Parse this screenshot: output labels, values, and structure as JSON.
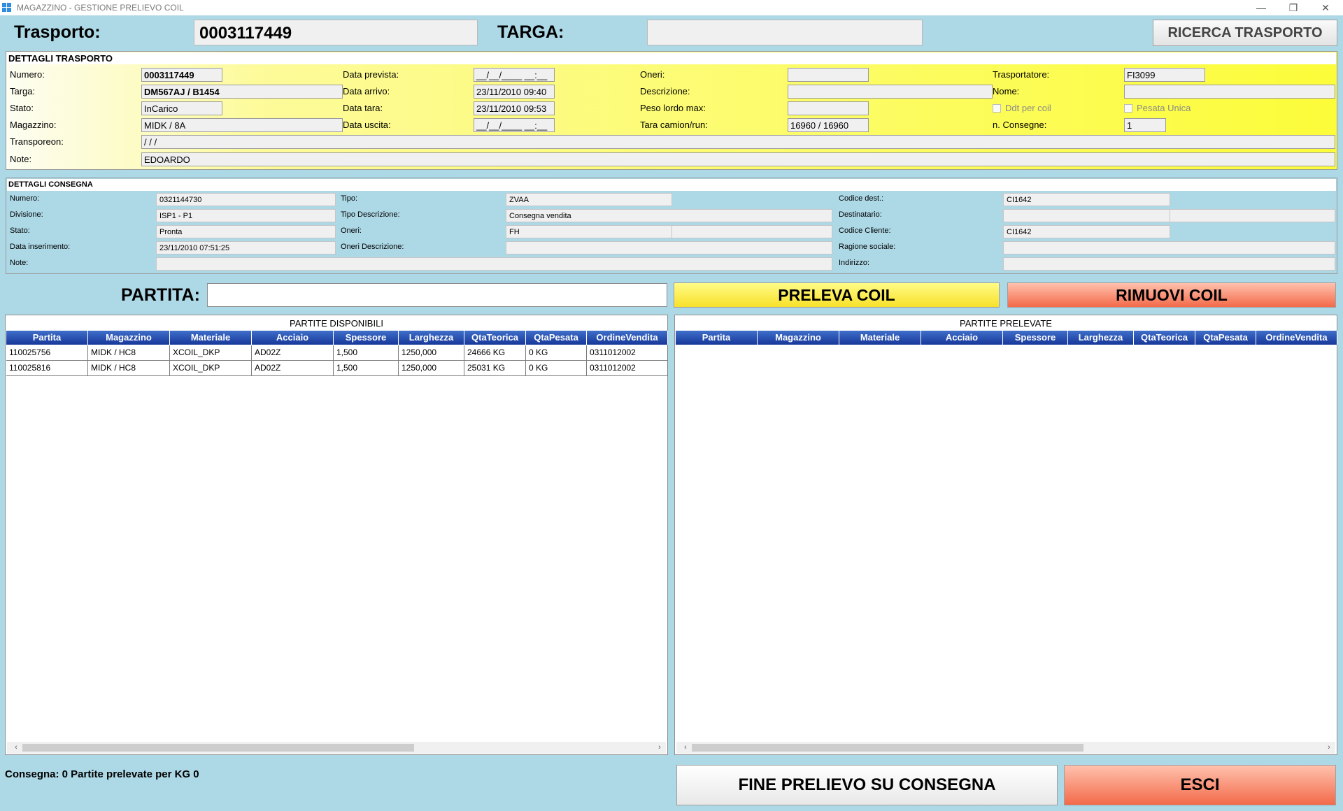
{
  "window": {
    "title": "MAGAZZINO - GESTIONE PRELIEVO COIL",
    "minimize": "—",
    "restore": "❐",
    "close": "✕"
  },
  "header": {
    "trasporto_label": "Trasporto:",
    "trasporto_value": "0003117449",
    "targa_label": "TARGA:",
    "targa_value": "",
    "search_button": "RICERCA TRASPORTO"
  },
  "trasporto": {
    "title": "DETTAGLI TRASPORTO",
    "numero": {
      "label": "Numero:",
      "value": "0003117449"
    },
    "targa": {
      "label": "Targa:",
      "value": "DM567AJ / B1454"
    },
    "stato": {
      "label": "Stato:",
      "value": "InCarico"
    },
    "magazzino": {
      "label": "Magazzino:",
      "value": "MIDK / 8A"
    },
    "transporeon": {
      "label": "Transporeon:",
      "value": " /  /  /"
    },
    "note": {
      "label": "Note:",
      "value": "EDOARDO"
    },
    "data_prevista": {
      "label": "Data prevista:",
      "value": "__/__/____ __:__"
    },
    "data_arrivo": {
      "label": "Data arrivo:",
      "value": "23/11/2010 09:40"
    },
    "data_tara": {
      "label": "Data tara:",
      "value": "23/11/2010 09:53"
    },
    "data_uscita": {
      "label": "Data uscita:",
      "value": "__/__/____ __:__"
    },
    "oneri": {
      "label": "Oneri:",
      "value": ""
    },
    "descrizione": {
      "label": "Descrizione:",
      "value": ""
    },
    "peso_lordo": {
      "label": "Peso lordo max:",
      "value": ""
    },
    "tara_camion": {
      "label": "Tara camion/run:",
      "value": "16960 / 16960"
    },
    "trasportatore": {
      "label": "Trasportatore:",
      "value": "FI3099"
    },
    "nome": {
      "label": "Nome:",
      "value": ""
    },
    "ddt_per_coil": {
      "label": "Ddt per coil",
      "checked": false
    },
    "pesata_unica": {
      "label": "Pesata Unica",
      "checked": false
    },
    "n_consegne": {
      "label": "n. Consegne:",
      "value": "1"
    }
  },
  "consegna": {
    "title": "DETTAGLI CONSEGNA",
    "numero": {
      "label": "Numero:",
      "value": "0321144730"
    },
    "divisione": {
      "label": "Divisione:",
      "value": "ISP1 - P1"
    },
    "stato": {
      "label": "Stato:",
      "value": "Pronta"
    },
    "data_inserimento": {
      "label": "Data inserimento:",
      "value": "23/11/2010 07:51:25"
    },
    "note": {
      "label": "Note:",
      "value": ""
    },
    "tipo": {
      "label": "Tipo:",
      "value": "ZVAA"
    },
    "tipo_descrizione": {
      "label": "Tipo Descrizione:",
      "value": "Consegna vendita"
    },
    "oneri": {
      "label": "Oneri:",
      "value": "FH",
      "value2": ""
    },
    "oneri_descrizione": {
      "label": "Oneri Descrizione:",
      "value": ""
    },
    "codice_dest": {
      "label": "Codice dest.:",
      "value": "CI1642"
    },
    "destinatario": {
      "label": "Destinatario:",
      "value": "",
      "value2": ""
    },
    "codice_cliente": {
      "label": "Codice Cliente:",
      "value": "CI1642"
    },
    "ragione_sociale": {
      "label": "Ragione sociale:",
      "value": ""
    },
    "indirizzo": {
      "label": "Indirizzo:",
      "value": ""
    }
  },
  "partita": {
    "label": "PARTITA:",
    "value": "",
    "preleva_button": "PRELEVA COIL",
    "rimuovi_button": "RIMUOVI COIL"
  },
  "grid_columns": [
    "Partita",
    "Magazzino",
    "Materiale",
    "Acciaio",
    "Spessore",
    "Larghezza",
    "QtaTeorica",
    "QtaPesata",
    "OrdineVendita"
  ],
  "disponibili": {
    "title": "PARTITE DISPONIBILI",
    "rows": [
      [
        "110025756",
        "MIDK / HC8",
        "XCOIL_DKP",
        "AD02Z",
        "1,500",
        "1250,000",
        "24666 KG",
        "0 KG",
        "0311012002"
      ],
      [
        "110025816",
        "MIDK / HC8",
        "XCOIL_DKP",
        "AD02Z",
        "1,500",
        "1250,000",
        "25031 KG",
        "0 KG",
        "0311012002"
      ]
    ]
  },
  "prelevate": {
    "title": "PARTITE PRELEVATE",
    "rows": []
  },
  "scroll": {
    "left": "‹",
    "right": "›"
  },
  "footer": {
    "status": "Consegna: 0 Partite prelevate per KG 0",
    "fine_button": "FINE PRELIEVO SU CONSEGNA",
    "esci_button": "ESCI"
  }
}
